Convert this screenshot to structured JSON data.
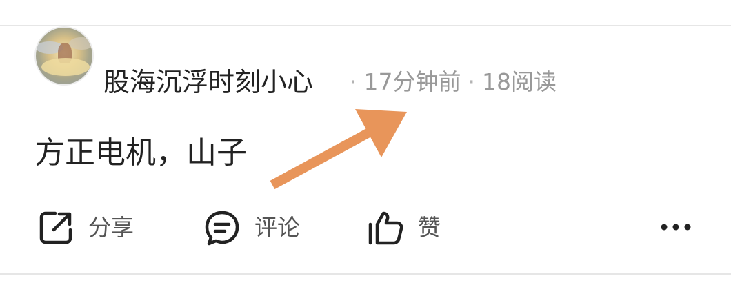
{
  "post": {
    "author_name": "股海沉浮时刻小心",
    "time_ago": "17分钟前",
    "reads": "18阅读",
    "meta_separator": "·",
    "content": "方正电机，山子"
  },
  "actions": {
    "share_label": "分享",
    "comment_label": "评论",
    "like_label": "赞"
  },
  "icons": {
    "share": "share-icon",
    "comment": "comment-icon",
    "like": "thumbs-up-icon",
    "more": "more-dots-icon",
    "annotation": "orange-arrow-annotation"
  },
  "colors": {
    "text_primary": "#222222",
    "text_meta": "#999999",
    "text_action": "#555555",
    "divider": "#e6e6e6",
    "annotation_arrow": "#e8955a"
  }
}
